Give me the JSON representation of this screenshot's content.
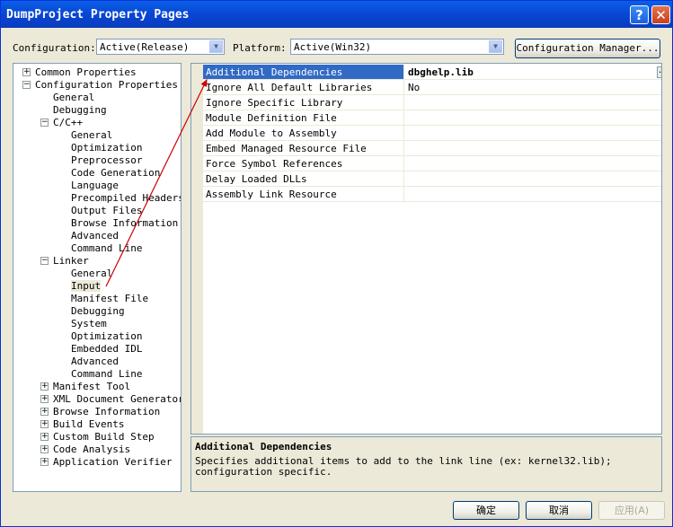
{
  "window": {
    "title": "DumpProject Property Pages"
  },
  "title_buttons": {
    "help": "?",
    "close": "✕"
  },
  "toolbar": {
    "configuration_label": "Configuration:",
    "configuration_value": "Active(Release)",
    "platform_label": "Platform:",
    "platform_value": "Active(Win32)",
    "config_manager_label": "Configuration Manager..."
  },
  "tree": [
    {
      "label": "Common Properties",
      "expander": "+"
    },
    {
      "label": "Configuration Properties",
      "expander": "−"
    },
    {
      "label": "General"
    },
    {
      "label": "Debugging"
    },
    {
      "label": "C/C++",
      "expander": "−"
    },
    {
      "label": "General"
    },
    {
      "label": "Optimization"
    },
    {
      "label": "Preprocessor"
    },
    {
      "label": "Code Generation"
    },
    {
      "label": "Language"
    },
    {
      "label": "Precompiled Headers"
    },
    {
      "label": "Output Files"
    },
    {
      "label": "Browse Information"
    },
    {
      "label": "Advanced"
    },
    {
      "label": "Command Line"
    },
    {
      "label": "Linker",
      "expander": "−"
    },
    {
      "label": "General"
    },
    {
      "label": "Input",
      "selected": true
    },
    {
      "label": "Manifest File"
    },
    {
      "label": "Debugging"
    },
    {
      "label": "System"
    },
    {
      "label": "Optimization"
    },
    {
      "label": "Embedded IDL"
    },
    {
      "label": "Advanced"
    },
    {
      "label": "Command Line"
    },
    {
      "label": "Manifest Tool",
      "expander": "+"
    },
    {
      "label": "XML Document Generator",
      "expander": "+"
    },
    {
      "label": "Browse Information",
      "expander": "+"
    },
    {
      "label": "Build Events",
      "expander": "+"
    },
    {
      "label": "Custom Build Step",
      "expander": "+"
    },
    {
      "label": "Code Analysis",
      "expander": "+"
    },
    {
      "label": "Application Verifier",
      "expander": "+"
    }
  ],
  "properties": [
    {
      "name": "Additional Dependencies",
      "value": "dbghelp.lib",
      "selected": true
    },
    {
      "name": "Ignore All Default Libraries",
      "value": "No"
    },
    {
      "name": "Ignore Specific Library",
      "value": ""
    },
    {
      "name": "Module Definition File",
      "value": ""
    },
    {
      "name": "Add Module to Assembly",
      "value": ""
    },
    {
      "name": "Embed Managed Resource File",
      "value": ""
    },
    {
      "name": "Force Symbol References",
      "value": ""
    },
    {
      "name": "Delay Loaded DLLs",
      "value": ""
    },
    {
      "name": "Assembly Link Resource",
      "value": ""
    }
  ],
  "ellipsis_label": "...",
  "description": {
    "title": "Additional Dependencies",
    "text": "Specifies additional items to add to the link line (ex: kernel32.lib); configuration specific."
  },
  "buttons": {
    "ok": "确定",
    "cancel": "取消",
    "apply": "应用(A)"
  },
  "annotation": {
    "arrow_color": "#cc0000"
  }
}
